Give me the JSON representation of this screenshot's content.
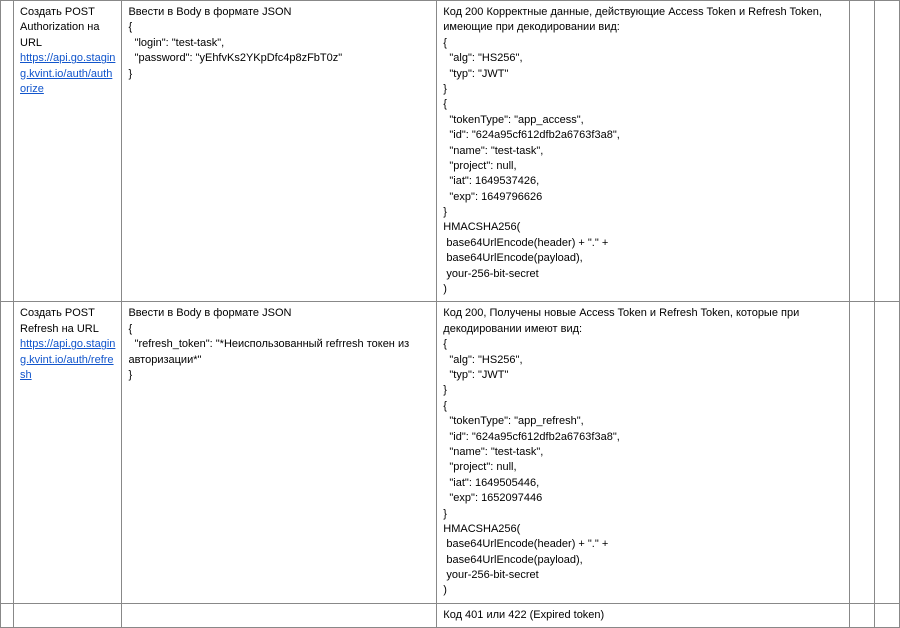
{
  "rows": [
    {
      "desc_prefix": "Создать POST Authorization на URL ",
      "desc_link_text": "https://api.go.staging.kvint.io/auth/authorize",
      "desc_link_href": "https://api.go.staging.kvint.io/auth/authorize",
      "body": "Ввести в Body в формате JSON\n{\n  \"login\": \"test-task\",\n  \"password\": \"yEhfvKs2YKpDfc4p8zFbT0z\"\n}",
      "result": "Код 200 Корректные данные, действующие Access Token и Refresh Token, имеющие при декодировании вид:\n{\n  \"alg\": \"HS256\",\n  \"typ\": \"JWT\"\n}\n{\n  \"tokenType\": \"app_access\",\n  \"id\": \"624a95cf612dfb2a6763f3a8\",\n  \"name\": \"test-task\",\n  \"project\": null,\n  \"iat\": 1649537426,\n  \"exp\": 1649796626\n}\nHMACSHA256(\n base64UrlEncode(header) + \".\" +\n base64UrlEncode(payload),\n your-256-bit-secret\n)"
    },
    {
      "desc_prefix": "Создать POST Refresh на URL ",
      "desc_link_text": "https://api.go.staging.kvint.io/auth/refresh",
      "desc_link_href": "https://api.go.staging.kvint.io/auth/refresh",
      "body": "Ввести в Body в формате JSON\n{\n  \"refresh_token\": \"*Неиспользованный refrresh токен из авторизации*\"\n}",
      "result": "Код 200, Получены новые Access Token и Refresh Token, которые при декодировании имеют вид:\n{\n  \"alg\": \"HS256\",\n  \"typ\": \"JWT\"\n}\n{\n  \"tokenType\": \"app_refresh\",\n  \"id\": \"624a95cf612dfb2a6763f3a8\",\n  \"name\": \"test-task\",\n  \"project\": null,\n  \"iat\": 1649505446,\n  \"exp\": 1652097446\n}\nHMACSHA256(\n base64UrlEncode(header) + \".\" +\n base64UrlEncode(payload),\n your-256-bit-secret\n)"
    },
    {
      "result": "Код 401 или 422 (Expired token)"
    }
  ]
}
